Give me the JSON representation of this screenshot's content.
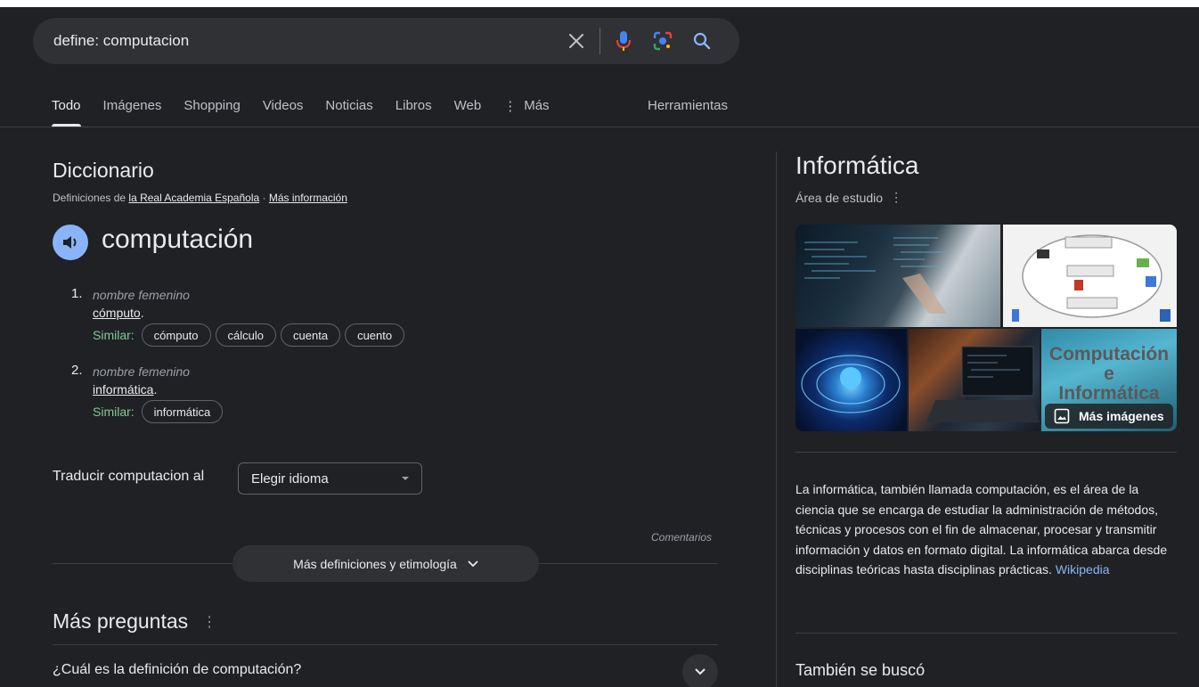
{
  "search": {
    "query": "define: computacion",
    "clear_icon": "close-icon",
    "voice_icon": "mic-icon",
    "lens_icon": "lens-icon",
    "search_icon": "search-icon"
  },
  "tabs": {
    "items": [
      "Todo",
      "Imágenes",
      "Shopping",
      "Videos",
      "Noticias",
      "Libros",
      "Web"
    ],
    "more": "Más",
    "tools": "Herramientas",
    "active": "Todo"
  },
  "dictionary": {
    "title": "Diccionario",
    "source_prefix": "Definiciones de",
    "source_link": "la Real Academia Española",
    "source_sep": "·",
    "more_info": "Más información",
    "headword": "computación",
    "senses": [
      {
        "num": "1.",
        "pos": "nombre femenino",
        "def_word": "cómputo",
        "def_end": ".",
        "similar_label": "Similar:",
        "similar": [
          "cómputo",
          "cálculo",
          "cuenta",
          "cuento"
        ]
      },
      {
        "num": "2.",
        "pos": "nombre femenino",
        "def_word": "informática",
        "def_end": ".",
        "similar_label": "Similar:",
        "similar": [
          "informática"
        ]
      }
    ],
    "translate_label": "Traducir computacion al",
    "translate_select": "Elegir idioma",
    "feedback": "Comentarios",
    "more_defs": "Más definiciones y etimología"
  },
  "questions": {
    "title": "Más preguntas",
    "items": [
      "¿Cuál es la definición de computación?"
    ]
  },
  "knowledge_panel": {
    "title": "Informática",
    "subtitle": "Área de estudio",
    "img5_text": [
      "Computación",
      "e",
      "Informática"
    ],
    "more_images": "Más imágenes",
    "description": "La informática,  también llamada computación,  es el área de la ciencia que se encarga de estudiar la administración de métodos, técnicas y procesos con el fin de almacenar, procesar y transmitir información y datos en formato digital. La informática abarca desde disciplinas teóricas hasta disciplinas prácticas.",
    "source": "Wikipedia",
    "also_searched": "También se buscó"
  },
  "colors": {
    "background": "#202124",
    "accent_blue": "#8ab4f8",
    "similar_green": "#81c995"
  }
}
